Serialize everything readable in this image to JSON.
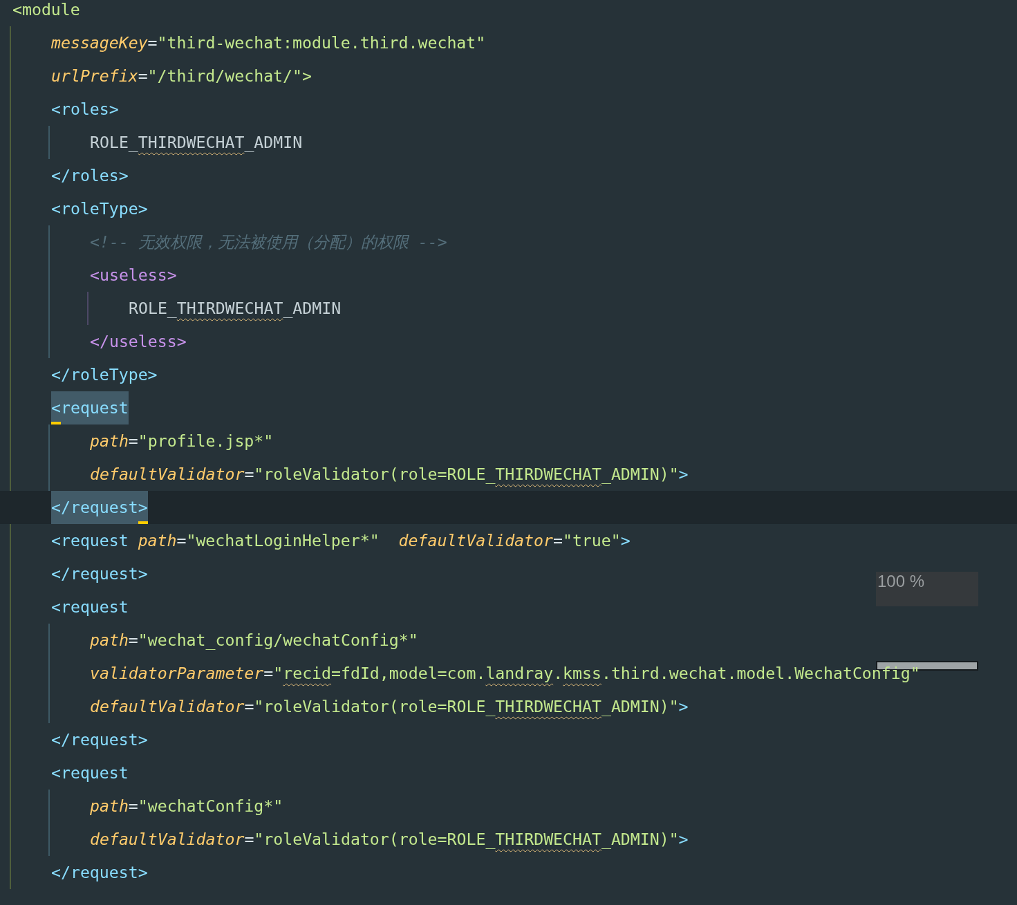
{
  "editor": {
    "lines": [
      {
        "tokens": [
          {
            "kind": "roottag",
            "text": "<module"
          }
        ],
        "children": [
          {
            "tokens": [
              {
                "kind": "attr",
                "text": "messageKey"
              },
              {
                "kind": "eq",
                "text": "="
              },
              {
                "kind": "value",
                "text": "\"third-wechat:module.third.wechat\""
              }
            ]
          },
          {
            "tokens": [
              {
                "kind": "attr",
                "text": "urlPrefix"
              },
              {
                "kind": "eq",
                "text": "="
              },
              {
                "kind": "value",
                "text": "\"/third/wechat/\""
              },
              {
                "kind": "roottag",
                "text": ">"
              }
            ]
          },
          {
            "tokens": [
              {
                "kind": "tag",
                "text": "<roles>"
              }
            ],
            "children": [
              {
                "tokens": [
                  {
                    "kind": "text",
                    "text": "ROLE_"
                  },
                  {
                    "kind": "text",
                    "text": "THIRDWECHAT",
                    "typo": true
                  },
                  {
                    "kind": "text",
                    "text": "_ADMIN"
                  }
                ]
              }
            ]
          },
          {
            "tokens": [
              {
                "kind": "tag",
                "text": "</roles>"
              }
            ]
          },
          {
            "tokens": [
              {
                "kind": "tag",
                "text": "<roleType>"
              }
            ],
            "children": [
              {
                "tokens": [
                  {
                    "kind": "comment",
                    "text": "<!-- 无效权限，无法被使用（分配）的权限 -->"
                  }
                ]
              },
              {
                "tokens": [
                  {
                    "kind": "customtag",
                    "text": "<useless>"
                  }
                ],
                "children": [
                  {
                    "tokens": [
                      {
                        "kind": "text",
                        "text": "ROLE_"
                      },
                      {
                        "kind": "text",
                        "text": "THIRDWECHAT",
                        "typo": true
                      },
                      {
                        "kind": "text",
                        "text": "_ADMIN"
                      }
                    ]
                  }
                ]
              },
              {
                "tokens": [
                  {
                    "kind": "customtag",
                    "text": "</useless>"
                  }
                ]
              }
            ]
          },
          {
            "tokens": [
              {
                "kind": "tag",
                "text": "</roleType>"
              }
            ]
          },
          {
            "tokens": [
              {
                "kind": "tag",
                "text": "<",
                "matched": true,
                "brace": true
              },
              {
                "kind": "tag",
                "text": "request",
                "matched": true
              }
            ],
            "children": [
              {
                "tokens": [
                  {
                    "kind": "attr",
                    "text": "path"
                  },
                  {
                    "kind": "eq",
                    "text": "="
                  },
                  {
                    "kind": "value",
                    "text": "\"profile.jsp*\""
                  }
                ]
              },
              {
                "tokens": [
                  {
                    "kind": "attr",
                    "text": "defaultValidator"
                  },
                  {
                    "kind": "eq",
                    "text": "="
                  },
                  {
                    "kind": "value",
                    "text": "\"roleValidator(role=ROLE_"
                  },
                  {
                    "kind": "value",
                    "text": "THIRDWECHAT",
                    "typo": true
                  },
                  {
                    "kind": "value",
                    "text": "_ADMIN)\""
                  },
                  {
                    "kind": "tag",
                    "text": ">"
                  }
                ]
              }
            ]
          },
          {
            "current": true,
            "tokens": [
              {
                "kind": "tag",
                "text": "</request",
                "matched": true
              },
              {
                "kind": "tag",
                "text": ">",
                "matched": true,
                "brace": true
              }
            ]
          },
          {
            "tokens": [
              {
                "kind": "tag",
                "text": "<request "
              },
              {
                "kind": "attr",
                "text": "path"
              },
              {
                "kind": "eq",
                "text": "="
              },
              {
                "kind": "value",
                "text": "\"wechatLoginHelper*\"  "
              },
              {
                "kind": "attr",
                "text": "defaultValidator"
              },
              {
                "kind": "eq",
                "text": "="
              },
              {
                "kind": "value",
                "text": "\"true\""
              },
              {
                "kind": "tag",
                "text": ">"
              }
            ]
          },
          {
            "tokens": [
              {
                "kind": "tag",
                "text": "</request>"
              }
            ]
          },
          {
            "tokens": [
              {
                "kind": "tag",
                "text": "<request"
              }
            ],
            "children": [
              {
                "tokens": [
                  {
                    "kind": "attr",
                    "text": "path"
                  },
                  {
                    "kind": "eq",
                    "text": "="
                  },
                  {
                    "kind": "value",
                    "text": "\"wechat_config/wechatConfig*\""
                  }
                ]
              },
              {
                "tokens": [
                  {
                    "kind": "attr",
                    "text": "validatorParameter"
                  },
                  {
                    "kind": "eq",
                    "text": "="
                  },
                  {
                    "kind": "value",
                    "text": "\""
                  },
                  {
                    "kind": "value",
                    "text": "recid",
                    "typo": true
                  },
                  {
                    "kind": "value",
                    "text": "=fdId,model=com."
                  },
                  {
                    "kind": "value",
                    "text": "landray",
                    "typo": true
                  },
                  {
                    "kind": "value",
                    "text": "."
                  },
                  {
                    "kind": "value",
                    "text": "kmss",
                    "typo": true
                  },
                  {
                    "kind": "value",
                    "text": ".third.wechat.model.WechatConfig\""
                  }
                ]
              },
              {
                "tokens": [
                  {
                    "kind": "attr",
                    "text": "defaultValidator"
                  },
                  {
                    "kind": "eq",
                    "text": "="
                  },
                  {
                    "kind": "value",
                    "text": "\"roleValidator(role=ROLE_"
                  },
                  {
                    "kind": "value",
                    "text": "THIRDWECHAT",
                    "typo": true
                  },
                  {
                    "kind": "value",
                    "text": "_ADMIN)\""
                  },
                  {
                    "kind": "tag",
                    "text": ">"
                  }
                ]
              }
            ]
          },
          {
            "tokens": [
              {
                "kind": "tag",
                "text": "</request>"
              }
            ]
          },
          {
            "tokens": [
              {
                "kind": "tag",
                "text": "<request"
              }
            ],
            "children": [
              {
                "tokens": [
                  {
                    "kind": "attr",
                    "text": "path"
                  },
                  {
                    "kind": "eq",
                    "text": "="
                  },
                  {
                    "kind": "value",
                    "text": "\"wechatConfig*\""
                  }
                ]
              },
              {
                "tokens": [
                  {
                    "kind": "attr",
                    "text": "defaultValidator"
                  },
                  {
                    "kind": "eq",
                    "text": "="
                  },
                  {
                    "kind": "value",
                    "text": "\"roleValidator(role=ROLE_"
                  },
                  {
                    "kind": "value",
                    "text": "THIRDWECHAT",
                    "typo": true
                  },
                  {
                    "kind": "value",
                    "text": "_ADMIN)\""
                  },
                  {
                    "kind": "tag",
                    "text": ">"
                  }
                ]
              }
            ]
          },
          {
            "tokens": [
              {
                "kind": "tag",
                "text": "</request>"
              }
            ]
          }
        ]
      }
    ]
  },
  "zoom_popup": {
    "label": "100 %"
  }
}
